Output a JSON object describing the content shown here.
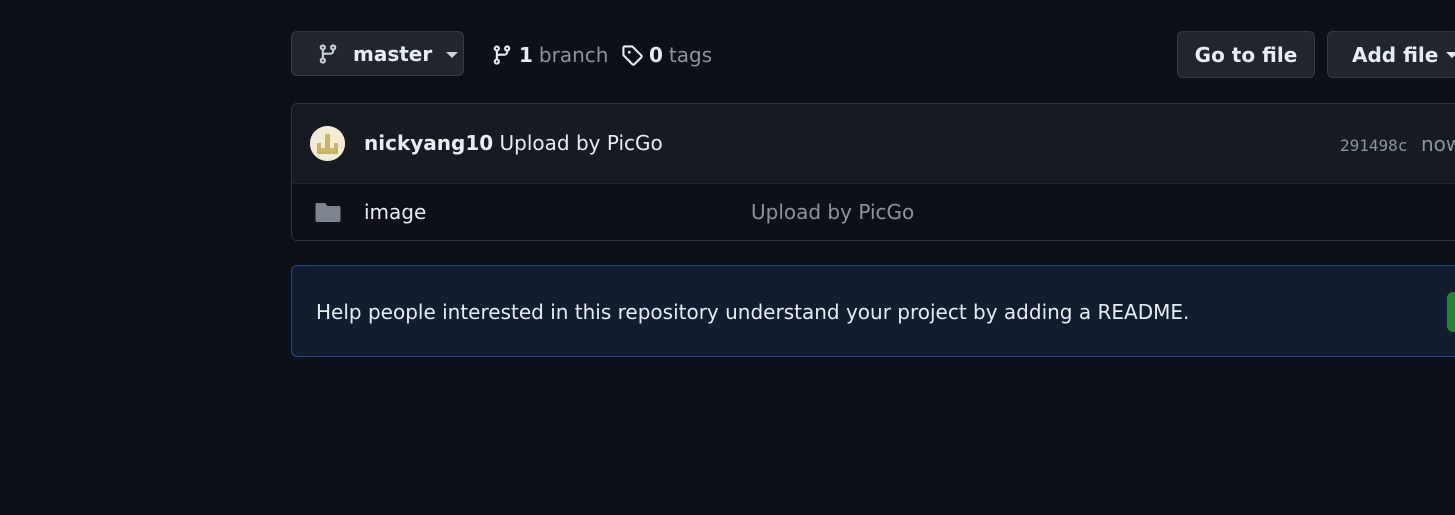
{
  "branch_selector": {
    "label": "master",
    "icon": "git-branch-icon"
  },
  "branches": {
    "count": "1",
    "label": "branch",
    "icon": "git-branch-icon"
  },
  "tags": {
    "count": "0",
    "label": "tags",
    "icon": "tag-icon"
  },
  "actions": {
    "goto_file": "Go to file",
    "add_file": "Add file"
  },
  "latest_commit": {
    "author": "nickyang10",
    "message": "Upload by PicGo",
    "sha": "291498c",
    "time": "now"
  },
  "files": [
    {
      "name": "image",
      "type": "folder",
      "icon": "folder-icon",
      "commit_message": "Upload by PicGo"
    }
  ],
  "readme_prompt": {
    "text": "Help people interested in this repository understand your project by adding a README."
  },
  "colors": {
    "background": "#0d1117",
    "button_bg": "#21262d",
    "muted_text": "#8b949e",
    "banner_bg": "#121d2f",
    "banner_border": "#1f4a86",
    "primary_green": "#238636"
  }
}
